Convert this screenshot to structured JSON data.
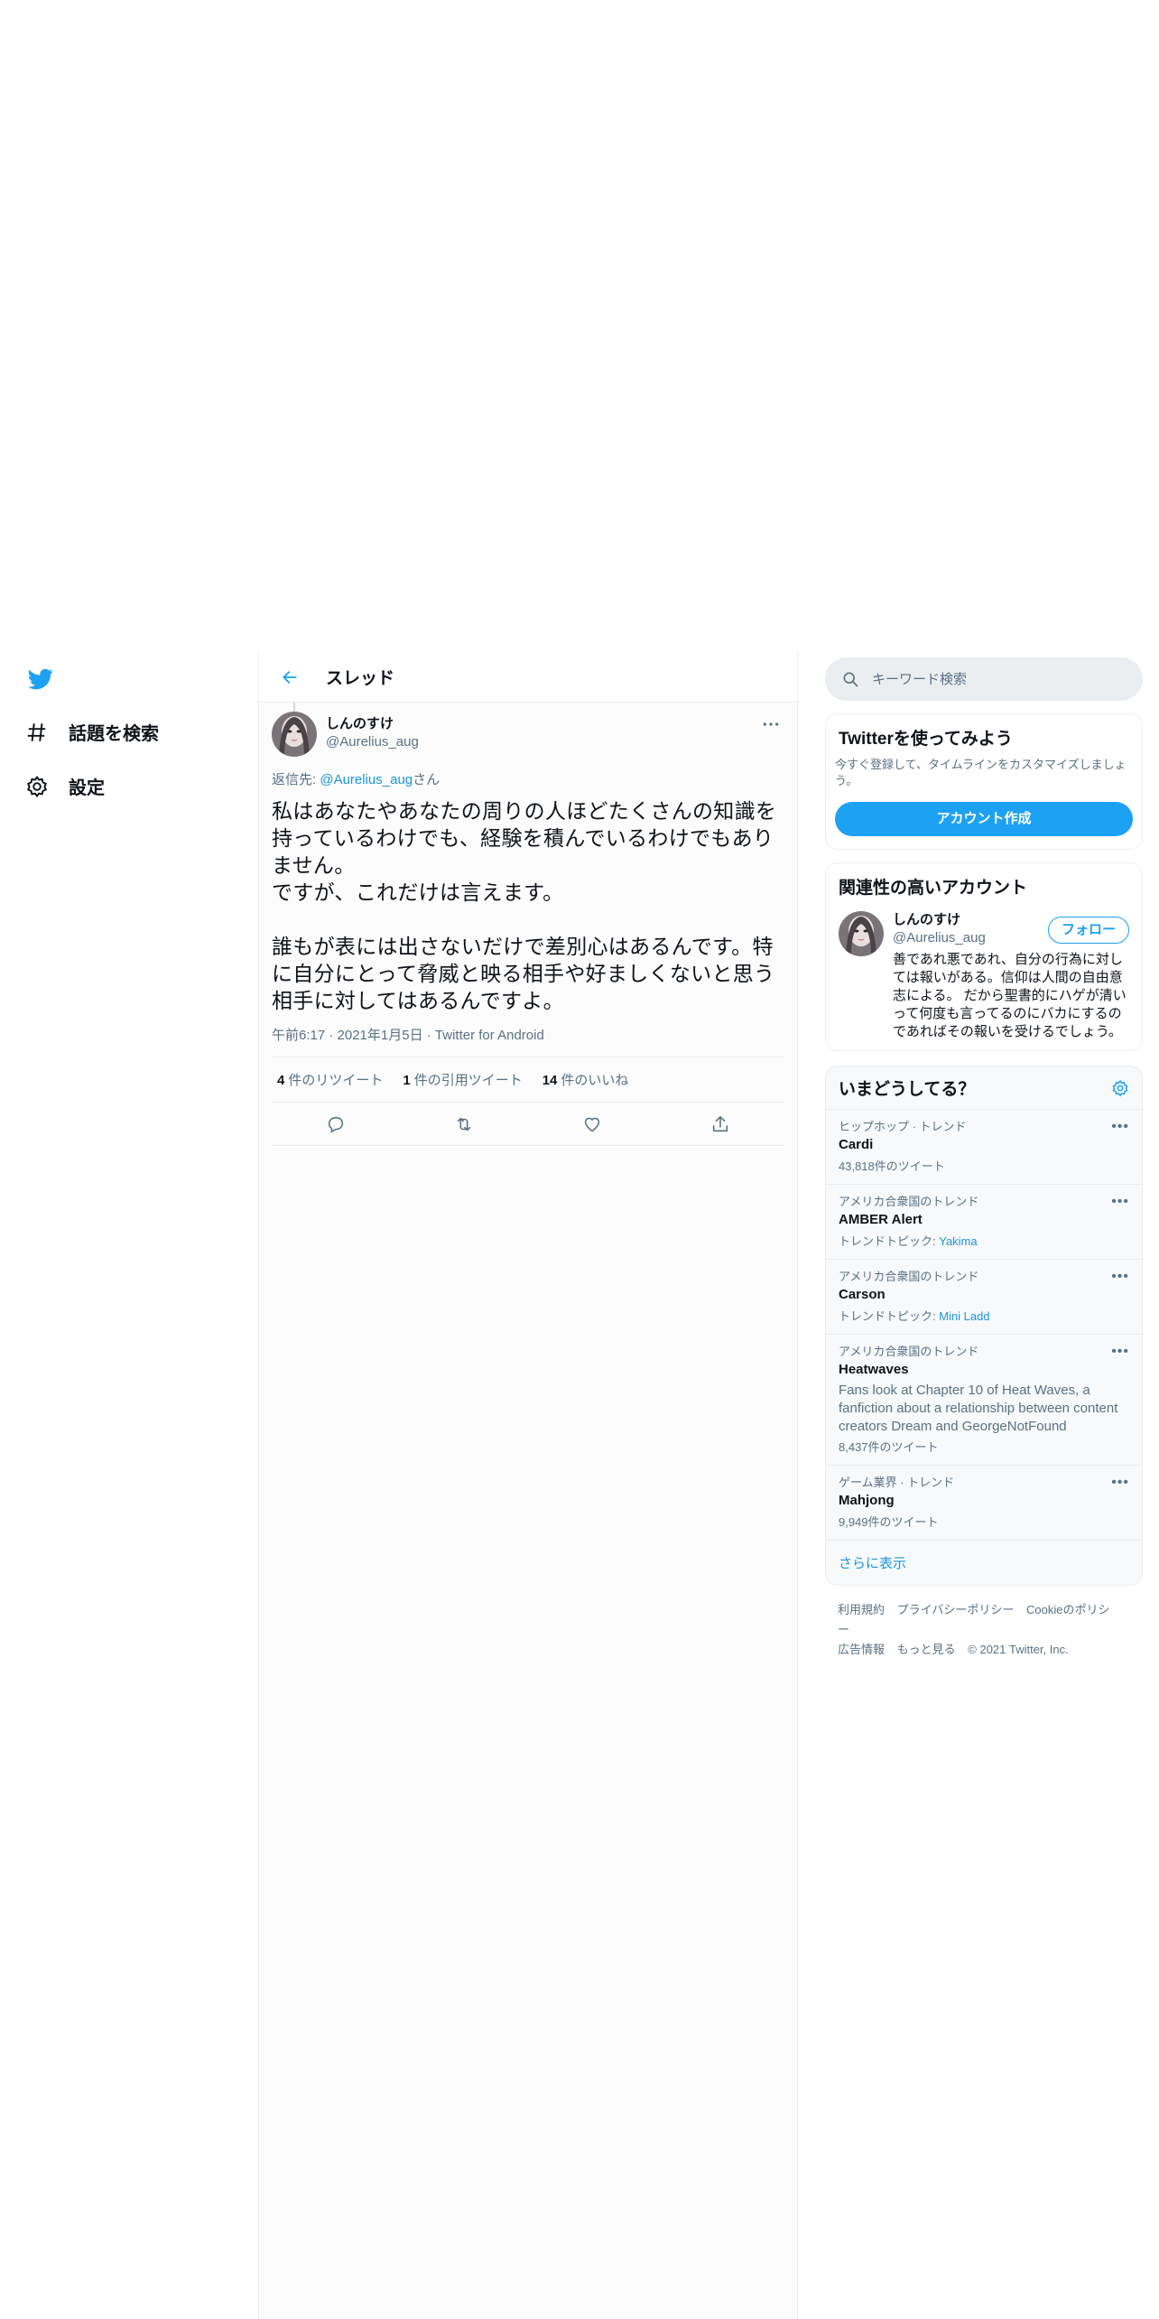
{
  "nav": {
    "explore_label": "話題を検索",
    "settings_label": "設定"
  },
  "header": {
    "title": "スレッド"
  },
  "tweet": {
    "display_name": "しんのすけ",
    "handle": "@Aurelius_aug",
    "reply_prefix": "返信先: ",
    "reply_mention": "@Aurelius_aug",
    "reply_suffix": "さん",
    "text": "私はあなたやあなたの周りの人ほどたくさんの知識を持っているわけでも、経験を積んでいるわけでもありません。\nですが、これだけは言えます。\n\n誰もが表には出さないだけで差別心はあるんです。特に自分にとって脅威と映る相手や好ましくないと思う相手に対してはあるんですよ。",
    "meta": "午前6:17 · 2021年1月5日 · Twitter for Android",
    "retweets_count": "4",
    "retweets_label": "件のリツイート",
    "quotes_count": "1",
    "quotes_label": "件の引用ツイート",
    "likes_count": "14",
    "likes_label": "件のいいね"
  },
  "search": {
    "placeholder": "キーワード検索"
  },
  "signup": {
    "title": "Twitterを使ってみよう",
    "subtitle": "今すぐ登録して、タイムラインをカスタマイズしましょう。",
    "button": "アカウント作成"
  },
  "related": {
    "title": "関連性の高いアカウント",
    "display_name": "しんのすけ",
    "handle": "@Aurelius_aug",
    "follow_label": "フォロー",
    "bio": "善であれ悪であれ、自分の行為に対しては報いがある。信仰は人間の自由意志による。 だから聖書的にハゲが清いって何度も言ってるのにバカにするのであればその報いを受けるでしょう。"
  },
  "trends": {
    "title": "いまどうしてる？",
    "items": [
      {
        "category": "ヒップホップ · トレンド",
        "name": "Cardi",
        "count": "43,818件のツイート"
      },
      {
        "category": "アメリカ合衆国のトレンド",
        "name": "AMBER Alert",
        "topic_label": "トレンドトピック: ",
        "topic_link": "Yakima"
      },
      {
        "category": "アメリカ合衆国のトレンド",
        "name": "Carson",
        "topic_label": "トレンドトピック: ",
        "topic_link": "Mini Ladd"
      },
      {
        "category": "アメリカ合衆国のトレンド",
        "name": "Heatwaves",
        "desc": "Fans look at Chapter 10 of Heat Waves, a fanfiction about a relationship between content creators Dream and GeorgeNotFound",
        "count": "8,437件のツイート"
      },
      {
        "category": "ゲーム業界 · トレンド",
        "name": "Mahjong",
        "count": "9,949件のツイート"
      }
    ],
    "show_more": "さらに表示"
  },
  "footer": {
    "terms": "利用規約",
    "privacy": "プライバシーポリシー",
    "cookie": "Cookieのポリシー",
    "ads": "広告情報",
    "more": "もっと見る",
    "copyright": "© 2021 Twitter, Inc."
  },
  "colors": {
    "accent": "#1da1f2",
    "link": "#1b95e0",
    "secondary_text": "#5b7083"
  }
}
